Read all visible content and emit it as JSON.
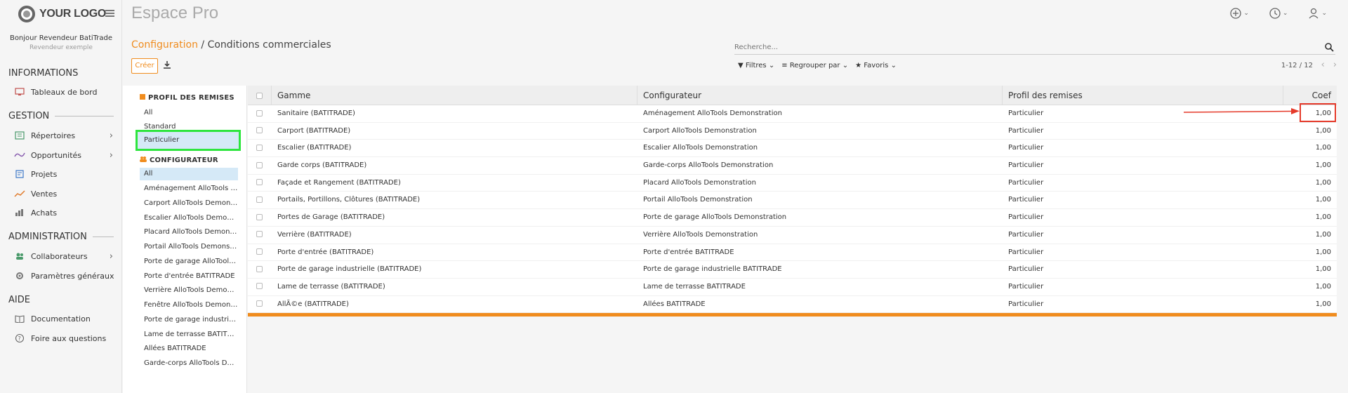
{
  "sidebar": {
    "logo": "YOUR LOGO",
    "greeting": "Bonjour Revendeur BatiTrade",
    "subtitle": "Revendeur exemple",
    "sections": {
      "informations": "INFORMATIONS",
      "gestion": "GESTION",
      "administration": "ADMINISTRATION",
      "aide": "AIDE"
    },
    "items": {
      "tableaux": "Tableaux de bord",
      "repertoires": "Répertoires",
      "opportunites": "Opportunités",
      "projets": "Projets",
      "ventes": "Ventes",
      "achats": "Achats",
      "collaborateurs": "Collaborateurs",
      "parametres": "Paramètres généraux",
      "documentation": "Documentation",
      "faq": "Foire aux questions"
    }
  },
  "header": {
    "app_title": "Espace Pro",
    "breadcrumb_parent": "Configuration",
    "breadcrumb_sep": " / ",
    "breadcrumb_current": "Conditions commerciales",
    "search_placeholder": "Recherche...",
    "create_label": "Créer",
    "filters_label": "Filtres",
    "groupby_label": "Regrouper par",
    "favorites_label": "Favoris",
    "pager": "1-12 / 12"
  },
  "panel": {
    "profil_title": "PROFIL DES REMISES",
    "profil_items": [
      "All",
      "Standard",
      "Particulier"
    ],
    "config_title": "CONFIGURATEUR",
    "config_items": [
      "All",
      "Aménagement AlloTools De...",
      "Carport AlloTools Demonstra...",
      "Escalier AlloTools Demonstra...",
      "Placard AlloTools Demonstra...",
      "Portail AlloTools Demonstrat...",
      "Porte de garage AlloTools D...",
      "Porte d'entrée BATITRADE",
      "Verrière AlloTools Demonstr...",
      "Fenêtre AlloTools Demonstra...",
      "Porte de garage industrielle...",
      "Lame de terrasse BATITRADE",
      "Allées BATITRADE",
      "Garde-corps AlloTools Demo..."
    ]
  },
  "table": {
    "headers": [
      "Gamme",
      "Configurateur",
      "Profil des remises",
      "Coef"
    ],
    "rows": [
      [
        "Sanitaire (BATITRADE)",
        "Aménagement AlloTools Demonstration",
        "Particulier",
        "1,00"
      ],
      [
        "Carport (BATITRADE)",
        "Carport AlloTools Demonstration",
        "Particulier",
        "1,00"
      ],
      [
        "Escalier (BATITRADE)",
        "Escalier AlloTools Demonstration",
        "Particulier",
        "1,00"
      ],
      [
        "Garde corps (BATITRADE)",
        "Garde-corps AlloTools Demonstration",
        "Particulier",
        "1,00"
      ],
      [
        "Façade et Rangement (BATITRADE)",
        "Placard AlloTools Demonstration",
        "Particulier",
        "1,00"
      ],
      [
        "Portails, Portillons, Clôtures (BATITRADE)",
        "Portail AlloTools Demonstration",
        "Particulier",
        "1,00"
      ],
      [
        "Portes de Garage (BATITRADE)",
        "Porte de garage AlloTools Demonstration",
        "Particulier",
        "1,00"
      ],
      [
        "Verrière (BATITRADE)",
        "Verrière AlloTools Demonstration",
        "Particulier",
        "1,00"
      ],
      [
        "Porte d'entrée (BATITRADE)",
        "Porte d'entrée BATITRADE",
        "Particulier",
        "1,00"
      ],
      [
        "Porte de garage industrielle (BATITRADE)",
        "Porte de garage industrielle BATITRADE",
        "Particulier",
        "1,00"
      ],
      [
        "Lame de terrasse (BATITRADE)",
        "Lame de terrasse BATITRADE",
        "Particulier",
        "1,00"
      ],
      [
        "AllÃ©e (BATITRADE)",
        "Allées BATITRADE",
        "Particulier",
        "1,00"
      ]
    ]
  },
  "colors": {
    "accent": "#f08c1e",
    "highlight_red": "#e53a2a",
    "highlight_green": "#2ee53e",
    "active_bg": "#d5e9f7"
  }
}
